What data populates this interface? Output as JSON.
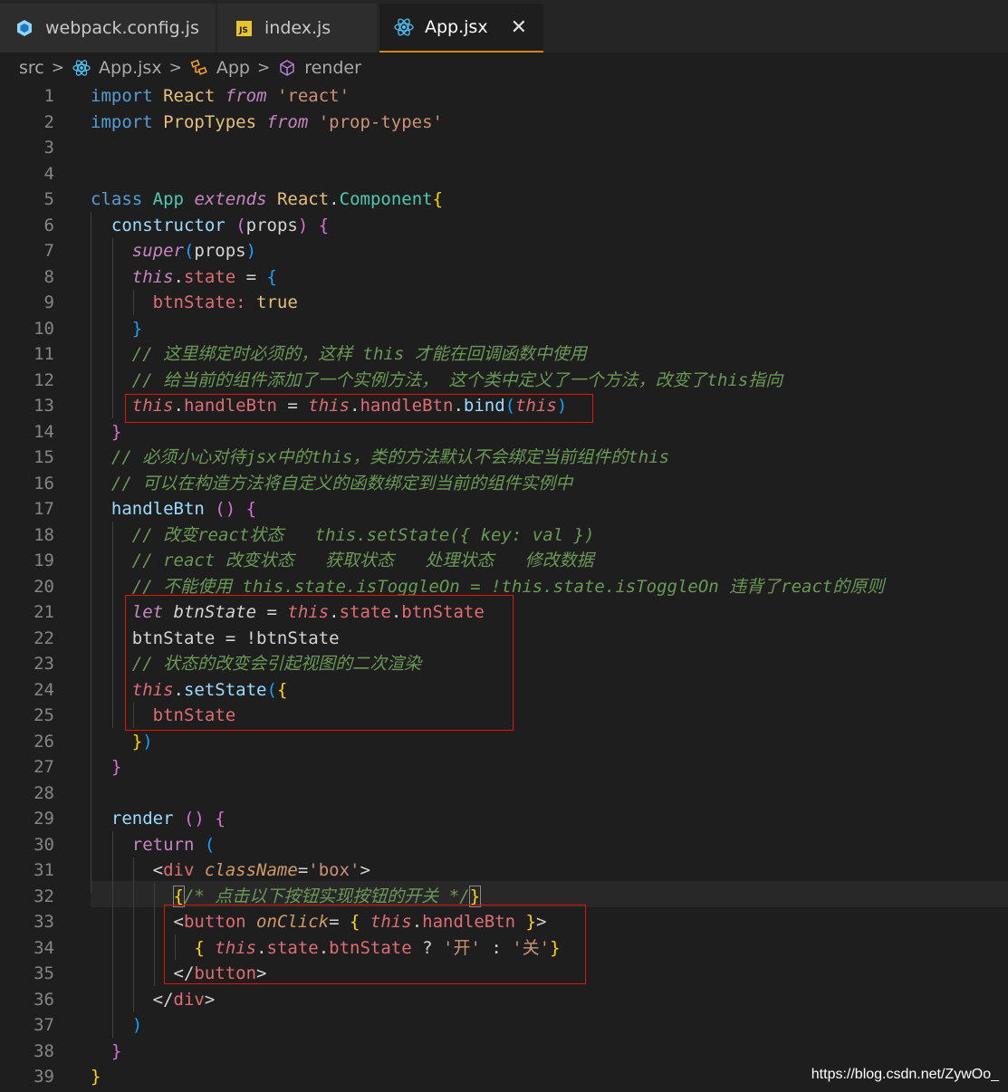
{
  "tabs": [
    {
      "label": "webpack.config.js",
      "icon": "webpack-icon"
    },
    {
      "label": "index.js",
      "icon": "js-icon",
      "badge": "JS"
    },
    {
      "label": "App.jsx",
      "icon": "react-icon",
      "active": true,
      "close": "✕"
    }
  ],
  "breadcrumb": [
    "src",
    "App.jsx",
    "App",
    "render"
  ],
  "watermark": "https://blog.csdn.net/ZywOo_",
  "colors": {
    "red_box": "#e51400",
    "tab_active_border": "#d18616"
  },
  "code_lines": [
    "import React from 'react'",
    "import PropTypes from 'prop-types'",
    "",
    "",
    "class App extends React.Component{",
    "  constructor (props) {",
    "    super(props)",
    "    this.state = {",
    "      btnState: true",
    "    }",
    "    // 这里绑定时必须的，这样 this 才能在回调函数中使用",
    "    // 给当前的组件添加了一个实例方法， 这个类中定义了一个方法，改变了this指向",
    "    this.handleBtn = this.handleBtn.bind(this)",
    "  }",
    "  // 必须小心对待jsx中的this，类的方法默认不会绑定当前组件的this",
    "  // 可以在构造方法将自定义的函数绑定到当前的组件实例中",
    "  handleBtn () {",
    "    // 改变react状态   this.setState({ key: val })",
    "    // react 改变状态   获取状态   处理状态   修改数据",
    "    // 不能使用 this.state.isToggleOn = !this.state.isToggleOn 违背了react的原则",
    "    let btnState = this.state.btnState",
    "    btnState = !btnState",
    "    // 状态的改变会引起视图的二次渲染",
    "    this.setState({",
    "      btnState",
    "    })",
    "  }",
    "",
    "  render () {",
    "    return (",
    "      <div className='box'>",
    "        {/* 点击以下按钮实现按钮的开关 */}",
    "        <button onClick= { this.handleBtn }>",
    "          { this.state.btnState ? '开' : '关'}",
    "        </button>",
    "      </div>",
    "    )",
    "  }",
    "}"
  ]
}
